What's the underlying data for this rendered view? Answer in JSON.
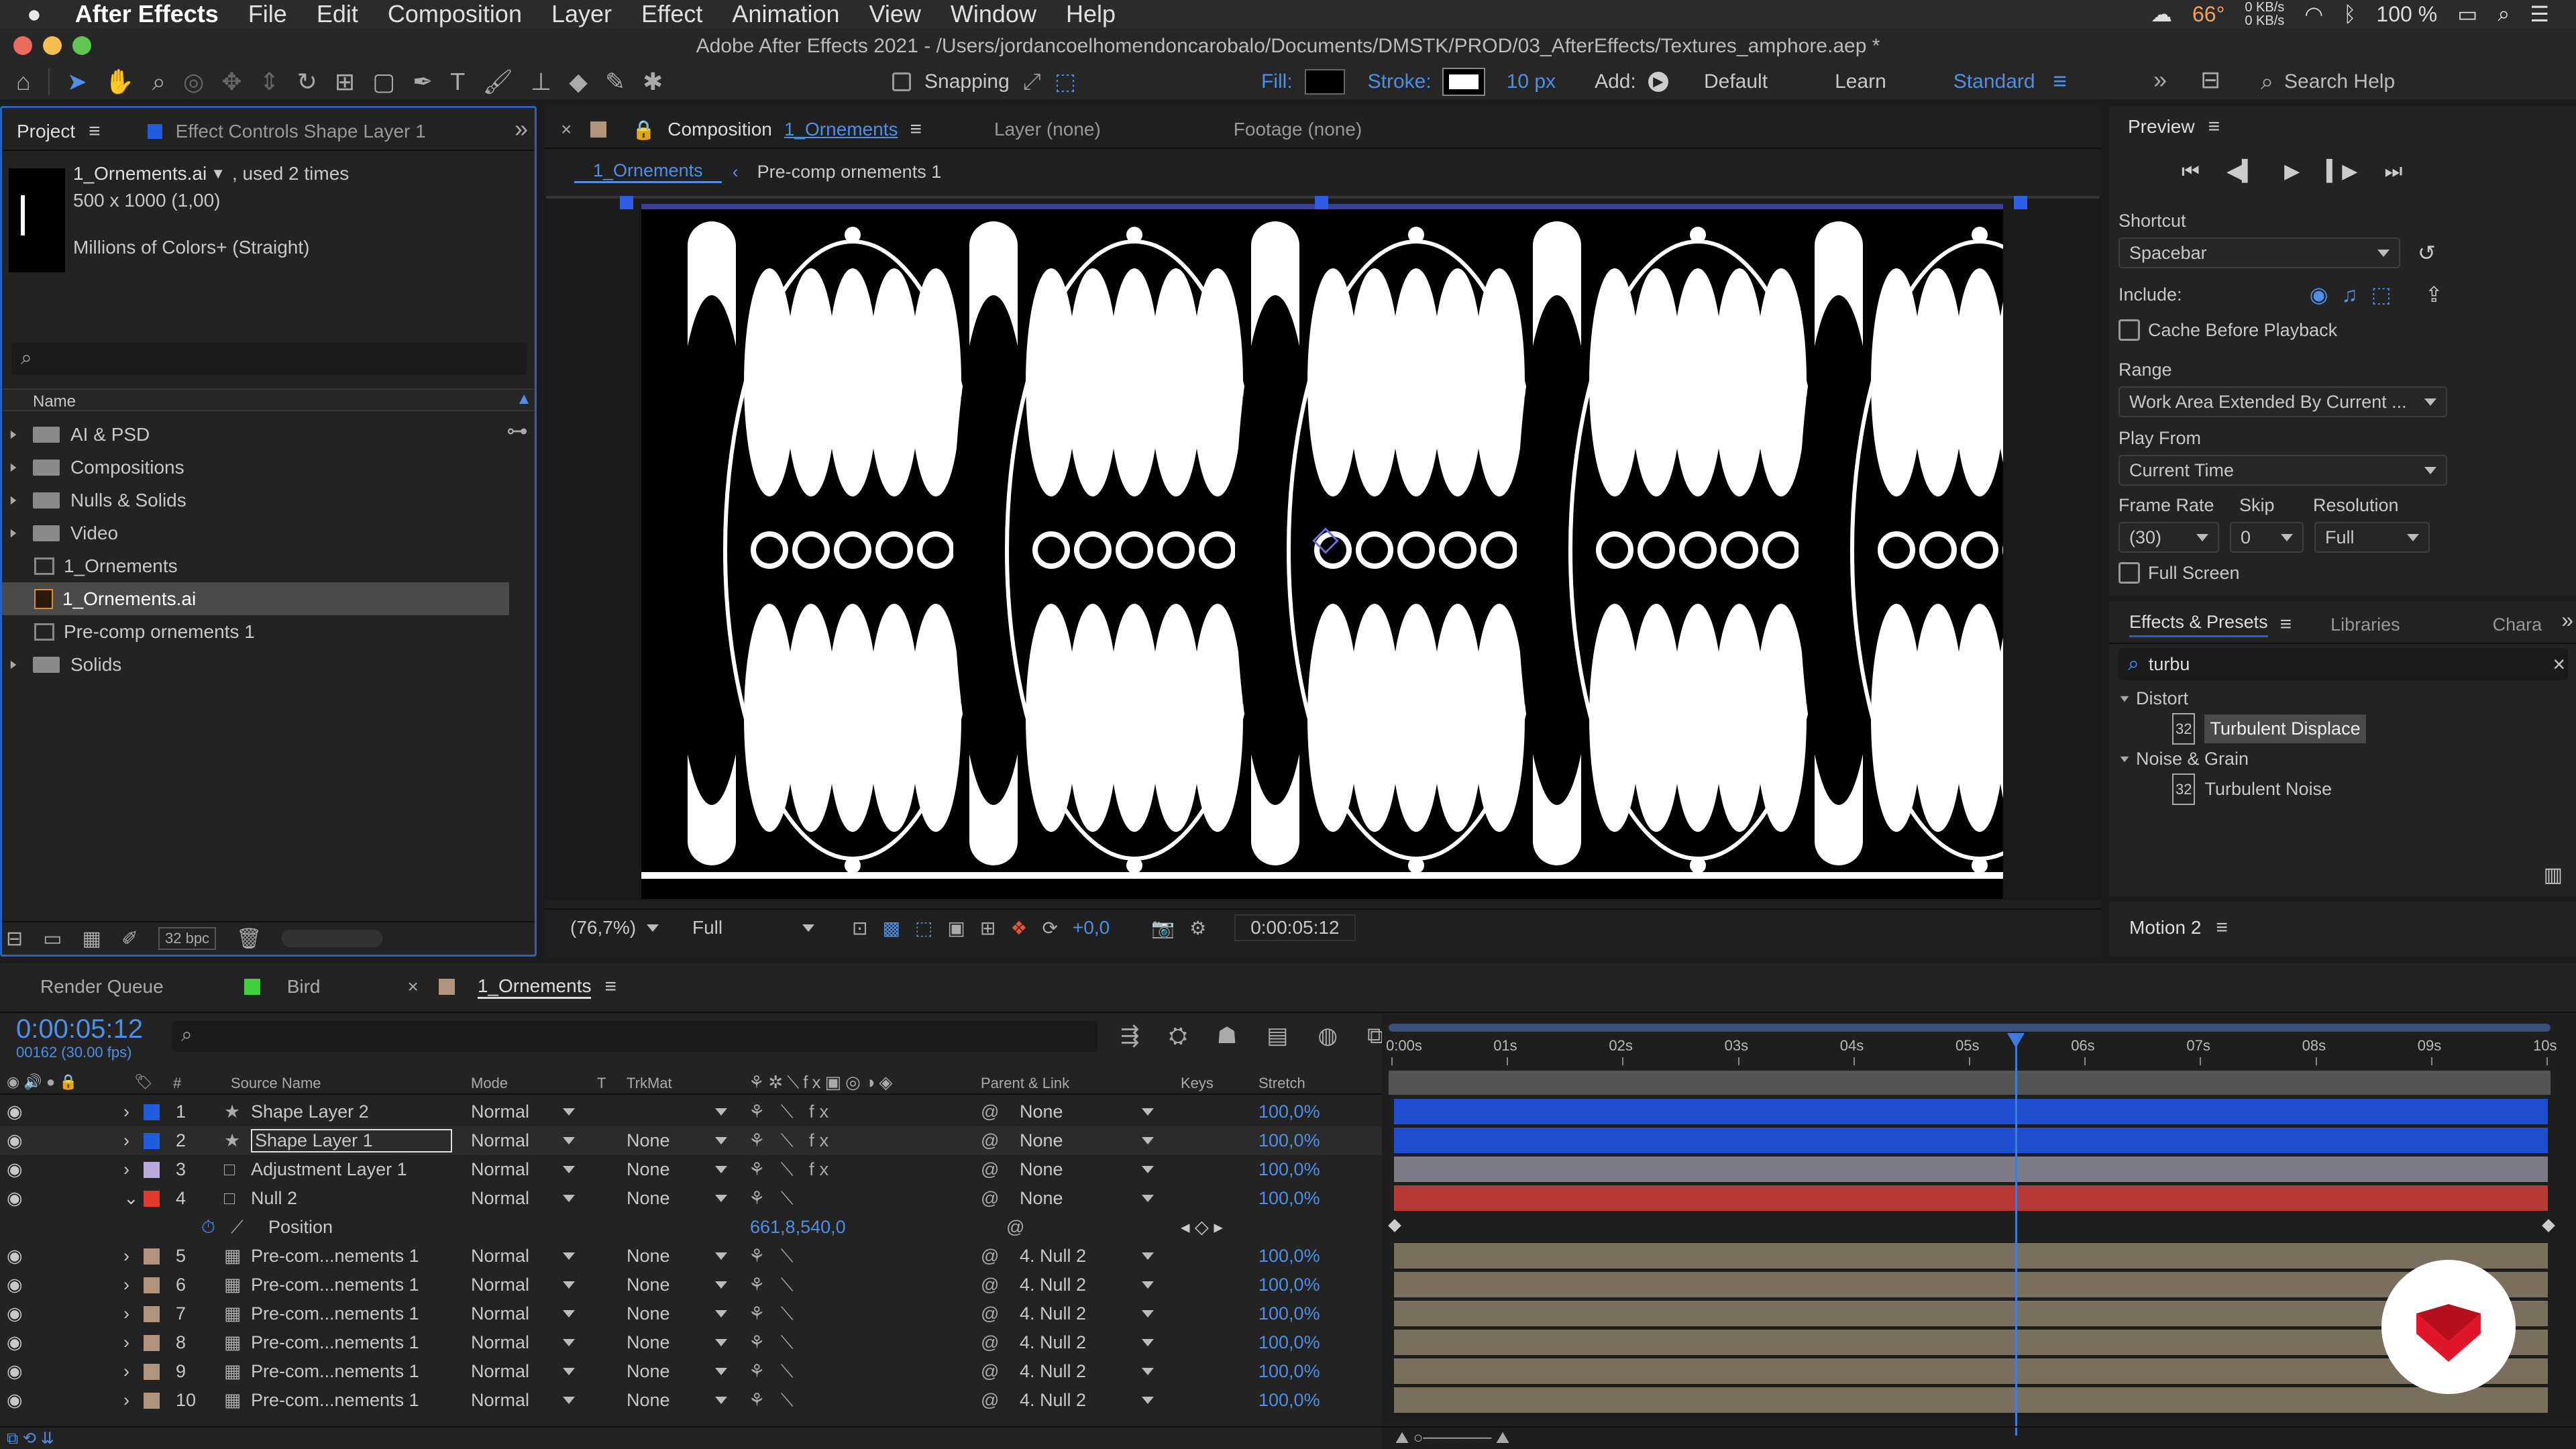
{
  "menubar": {
    "apple": "",
    "app": "After Effects",
    "items": [
      "File",
      "Edit",
      "Composition",
      "Layer",
      "Effect",
      "Animation",
      "View",
      "Window",
      "Help"
    ],
    "status": {
      "temp": "66°",
      "net_up": "0 KB/s",
      "net_down": "0 KB/s",
      "battery": "100 %"
    }
  },
  "window": {
    "title": "Adobe After Effects 2021 - /Users/jordancoelhomendoncarobalo/Documents/DMSTK/PROD/03_AfterEffects/Textures_amphore.aep *"
  },
  "toolbar": {
    "snapping": "Snapping",
    "fill": "Fill:",
    "stroke": "Stroke:",
    "stroke_px": "10 px",
    "add": "Add:",
    "workspaces": [
      "Default",
      "Learn",
      "Standard"
    ],
    "search": "Search Help"
  },
  "project": {
    "tab_project": "Project",
    "tab_effect": "Effect Controls Shape Layer 1",
    "item_name": "1_Ornements.ai",
    "item_used": ", used 2 times",
    "item_dims": "500 x 1000 (1,00)",
    "item_colors": "Millions of Colors+ (Straight)",
    "col_name": "Name",
    "bpc": "32 bpc",
    "items": [
      {
        "label": "AI & PSD",
        "type": "folder"
      },
      {
        "label": "Compositions",
        "type": "folder"
      },
      {
        "label": "Nulls & Solids",
        "type": "folder"
      },
      {
        "label": "Video",
        "type": "folder"
      },
      {
        "label": "1_Ornements",
        "type": "comp"
      },
      {
        "label": "1_Ornements.ai",
        "type": "ai"
      },
      {
        "label": "Pre-comp ornements 1",
        "type": "comp"
      },
      {
        "label": "Solids",
        "type": "folder"
      }
    ]
  },
  "composition": {
    "tab_prefix": "Composition",
    "tab_name": "1_Ornements",
    "tab_layer": "Layer (none)",
    "tab_footage": "Footage (none)",
    "crumbs": [
      "1_Ornements",
      "Pre-comp ornements 1"
    ],
    "zoom": "(76,7%)",
    "quality": "Full",
    "exposure": "+0,0",
    "timecode": "0:00:05:12"
  },
  "preview": {
    "title": "Preview",
    "shortcut_label": "Shortcut",
    "shortcut": "Spacebar",
    "include": "Include:",
    "cache": "Cache Before Playback",
    "range_label": "Range",
    "range": "Work Area Extended By Current ...",
    "playfrom_label": "Play From",
    "playfrom": "Current Time",
    "fr_label": "Frame Rate",
    "skip_label": "Skip",
    "res_label": "Resolution",
    "fr": "(30)",
    "skip": "0",
    "res": "Full",
    "fullscreen": "Full Screen"
  },
  "effects": {
    "tabs": [
      "Effects & Presets",
      "Libraries",
      "Chara"
    ],
    "search": "turbu",
    "groups": [
      {
        "name": "Distort",
        "item": "Turbulent Displace"
      },
      {
        "name": "Noise & Grain",
        "item": "Turbulent Noise"
      }
    ],
    "motion": "Motion 2"
  },
  "timeline": {
    "tabs": [
      "Render Queue",
      "Bird",
      "1_Ornements"
    ],
    "timecode": "0:00:05:12",
    "frames": "00162 (30.00 fps)",
    "headers": {
      "num": "#",
      "source": "Source Name",
      "mode": "Mode",
      "t": "T",
      "trkmat": "TrkMat",
      "parent": "Parent & Link",
      "keys": "Keys",
      "stretch": "Stretch"
    },
    "ruler": [
      "0:00s",
      "01s",
      "02s",
      "03s",
      "04s",
      "05s",
      "06s",
      "07s",
      "08s",
      "09s",
      "10s"
    ],
    "playhead_sec": 5.4,
    "layers": [
      {
        "num": "1",
        "color": "#1f5ce0",
        "icon": "★",
        "name": "Shape Layer 2",
        "mode": "Normal",
        "trk": "",
        "parent": "None",
        "stretch": "100,0%",
        "bar": "#1f4fd1",
        "fx": true
      },
      {
        "num": "2",
        "color": "#1f5ce0",
        "icon": "★",
        "name": "Shape Layer 1",
        "mode": "Normal",
        "trk": "None",
        "parent": "None",
        "stretch": "100,0%",
        "bar": "#1f4fd1",
        "fx": true,
        "selected": true
      },
      {
        "num": "3",
        "color": "#b9a9de",
        "icon": "□",
        "name": "Adjustment Layer 1",
        "mode": "Normal",
        "trk": "None",
        "parent": "None",
        "stretch": "100,0%",
        "bar": "#7e7a88",
        "fx": true
      },
      {
        "num": "4",
        "color": "#e03a2c",
        "icon": "□",
        "name": "Null 2",
        "mode": "Normal",
        "trk": "None",
        "parent": "None",
        "stretch": "100,0%",
        "bar": "#b83a36",
        "fx": false,
        "open": true
      },
      {
        "num": "5",
        "color": "#b1927a",
        "icon": "▦",
        "name": "Pre-com...nements 1",
        "mode": "Normal",
        "trk": "None",
        "parent": "4. Null 2",
        "stretch": "100,0%",
        "bar": "#7a6e5f",
        "fx": false
      },
      {
        "num": "6",
        "color": "#b1927a",
        "icon": "▦",
        "name": "Pre-com...nements 1",
        "mode": "Normal",
        "trk": "None",
        "parent": "4. Null 2",
        "stretch": "100,0%",
        "bar": "#7a6e5f",
        "fx": false
      },
      {
        "num": "7",
        "color": "#b1927a",
        "icon": "▦",
        "name": "Pre-com...nements 1",
        "mode": "Normal",
        "trk": "None",
        "parent": "4. Null 2",
        "stretch": "100,0%",
        "bar": "#7a6e5f",
        "fx": false
      },
      {
        "num": "8",
        "color": "#b1927a",
        "icon": "▦",
        "name": "Pre-com...nements 1",
        "mode": "Normal",
        "trk": "None",
        "parent": "4. Null 2",
        "stretch": "100,0%",
        "bar": "#7a6e5f",
        "fx": false
      },
      {
        "num": "9",
        "color": "#b1927a",
        "icon": "▦",
        "name": "Pre-com...nements 1",
        "mode": "Normal",
        "trk": "None",
        "parent": "4. Null 2",
        "stretch": "100,0%",
        "bar": "#7a6e5f",
        "fx": false
      },
      {
        "num": "10",
        "color": "#b1927a",
        "icon": "▦",
        "name": "Pre-com...nements 1",
        "mode": "Normal",
        "trk": "None",
        "parent": "4. Null 2",
        "stretch": "100,0%",
        "bar": "#7a6e5f",
        "fx": false
      }
    ],
    "position": {
      "label": "Position",
      "value": "661,8,540,0"
    }
  }
}
